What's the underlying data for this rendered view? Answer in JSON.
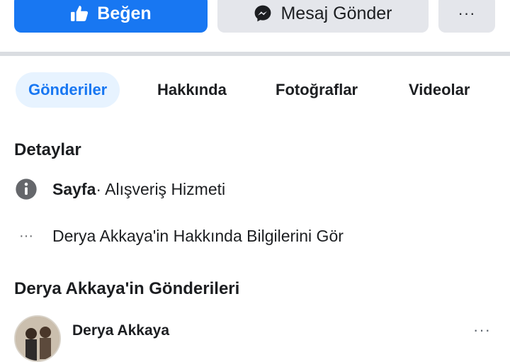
{
  "actions": {
    "like_label": "Beğen",
    "message_label": "Mesaj Gönder",
    "more_label": "···"
  },
  "tabs": [
    {
      "label": "Gönderiler",
      "active": true
    },
    {
      "label": "Hakkında",
      "active": false
    },
    {
      "label": "Fotoğraflar",
      "active": false
    },
    {
      "label": "Videolar",
      "active": false
    }
  ],
  "details": {
    "title": "Detaylar",
    "page_type_bold": "Sayfa",
    "page_type_rest": " · Alışveriş Hizmeti",
    "see_about": "Derya Akkaya'in Hakkında Bilgilerini Gör",
    "more_dots": "···"
  },
  "posts": {
    "title": "Derya Akkaya'in Gönderileri",
    "first_post_author": "Derya Akkaya",
    "more_dots": "···"
  },
  "colors": {
    "brand_blue": "#1877f2",
    "light_gray": "#e4e6eb",
    "text": "#1c1e21"
  },
  "icons": {
    "like": "thumbs-up-icon",
    "messenger": "messenger-icon",
    "info": "info-icon",
    "more": "more-dots-icon"
  }
}
